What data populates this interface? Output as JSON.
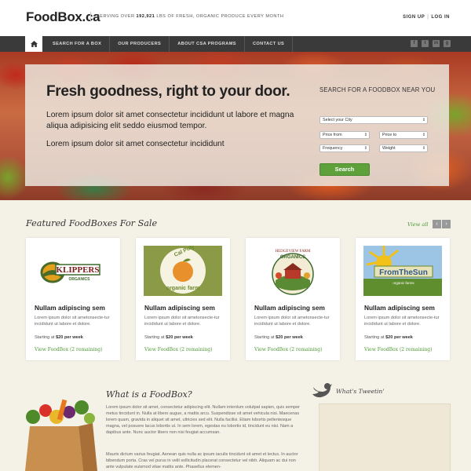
{
  "header": {
    "logo": "FoodBox.ca",
    "tagline_prefix": "SERVING OVER ",
    "tagline_count": "192,921",
    "tagline_suffix": " LBS OF FRESH, ORGANIC PRODUCE EVERY MONTH",
    "sign_up": "SIGN UP",
    "separator": "|",
    "log_in": "LOG IN"
  },
  "nav": {
    "items": [
      "SEARCH FOR A BOX",
      "OUR PRODUCERS",
      "ABOUT CSA PROGRAMS",
      "CONTACT US"
    ],
    "social_icons": [
      "facebook-icon",
      "twitter-icon",
      "linkedin-icon",
      "google-plus-icon"
    ]
  },
  "hero": {
    "title": "Fresh goodness, right to your door.",
    "paragraph1": "Lorem ipsum dolor sit amet consectetur incididunt ut labore et magna aliqua adipisicing elit seddo eiusmod tempor.",
    "paragraph2": "Lorem ipsum dolor sit amet consectetur incididunt"
  },
  "search": {
    "title": "SEARCH FOR A FOODBOX NEAR YOU",
    "city": "Select your City",
    "price_from": "Price from",
    "price_to": "Price to",
    "frequency": "Frequency",
    "weight": "Weight",
    "button": "Search"
  },
  "featured": {
    "title": "Featured FoodBoxes For Sale",
    "view_all": "View all",
    "cards": [
      {
        "logo_text": "KLIPPERS",
        "logo_sub": "ORGANICS",
        "name": "Nullam adipiscing sem",
        "desc": "Lorem ipsum dolor sit ametonsecte-tur incididunt ut labore et dolore.",
        "price_prefix": "Starting at ",
        "price": "$20 per week",
        "link": "View FoodBox (2 remaining)"
      },
      {
        "logo_text": "Cal Poly",
        "logo_sub": "organic farm",
        "name": "Nullam adipiscing sem",
        "desc": "Lorem ipsum dolor sit ametonsecte-tur incididunt ut labore et dolore.",
        "price_prefix": "Starting at ",
        "price": "$20 per week",
        "link": "View FoodBox (2 remaining)"
      },
      {
        "logo_text": "HEDGEVIEW FARM",
        "logo_sub": "ORGANICS",
        "name": "Nullam adipiscing sem",
        "desc": "Lorem ipsum dolor sit ametonsecte-tur incididunt ut labore et dolore.",
        "price_prefix": "Starting at ",
        "price": "$20 per week",
        "link": "View FoodBox (2 remaining)"
      },
      {
        "logo_text": "FromTheSun",
        "logo_sub": "organic farms",
        "name": "Nullam adipiscing sem",
        "desc": "Lorem ipsum dolor sit ametonsecte-tur incididunt ut labore et dolore.",
        "price_prefix": "Starting at ",
        "price": "$20 per week",
        "link": "View FoodBox (2 remaining)"
      }
    ]
  },
  "what": {
    "title": "What is a FoodBox?",
    "paragraph1": "Lorem ipsum dolor sit amet, consectetur adipiscing elit. Nullam interdum volutpat sapien, quis semper metus tincidunt in. Nulla at libero augue, a mattis arcu. Suspendisse sit amet vehicula nisi. Maecenas lorem quam, gravida in aliquet sit amet, ultricies sed elit. Nulla facilisi. Etiam lobortis pellentesque magna, vel posuere lacus lobortis ut. In sem lorem, egestas eu lobortis id, tincidunt eu nisi. Nam a dapibus ante. Nunc auctor libero non nisi feugiat accumsan.",
    "paragraph2": "Mauris dictum varius feugiat. Aenean quis nulla ac ipsum iaculis tincidunt sit amet et lectus. In auctor bibendum porta. Cras vel purus in velit sollicitudin placerat consectetur vel nibh. Aliquam ac dui non ante vulputate euismod vitae mattis ante. Phasellus elemen-"
  },
  "twitter": {
    "title": "What's Tweetin'"
  },
  "colors": {
    "accent_green": "#5ea13a",
    "nav_bg": "#3a3a3a",
    "page_bg": "#f4f1e7"
  }
}
